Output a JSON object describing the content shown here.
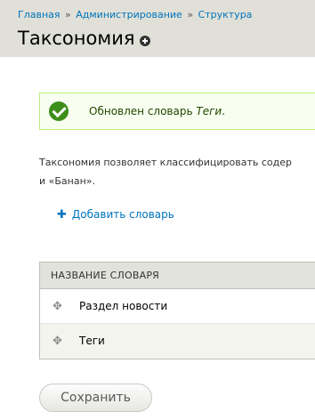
{
  "breadcrumb": {
    "items": [
      "Главная",
      "Администрирование",
      "Структура"
    ],
    "separator": "»"
  },
  "page": {
    "title": "Таксономия",
    "shortcut_icon": "plus-circle-icon"
  },
  "status": {
    "prefix": "Обновлен словарь ",
    "vocab": "Теги",
    "suffix": ".",
    "icon": "check-circle-icon"
  },
  "help": {
    "line1": "Таксономия позволяет классифицировать содер",
    "line2": "и «Банан»."
  },
  "add_vocabulary": {
    "label": "Добавить словарь",
    "icon": "plus-icon"
  },
  "table": {
    "header": "НАЗВАНИЕ СЛОВАРЯ",
    "rows": [
      {
        "name": "Раздел новости"
      },
      {
        "name": "Теги"
      }
    ],
    "drag_icon": "drag-handle-icon"
  },
  "actions": {
    "save_label": "Сохранить"
  },
  "colors": {
    "link": "#0074bd",
    "header_bg": "#e0e0d8",
    "status_bg": "#f8fff0",
    "status_icon": "#3e8e1a"
  }
}
